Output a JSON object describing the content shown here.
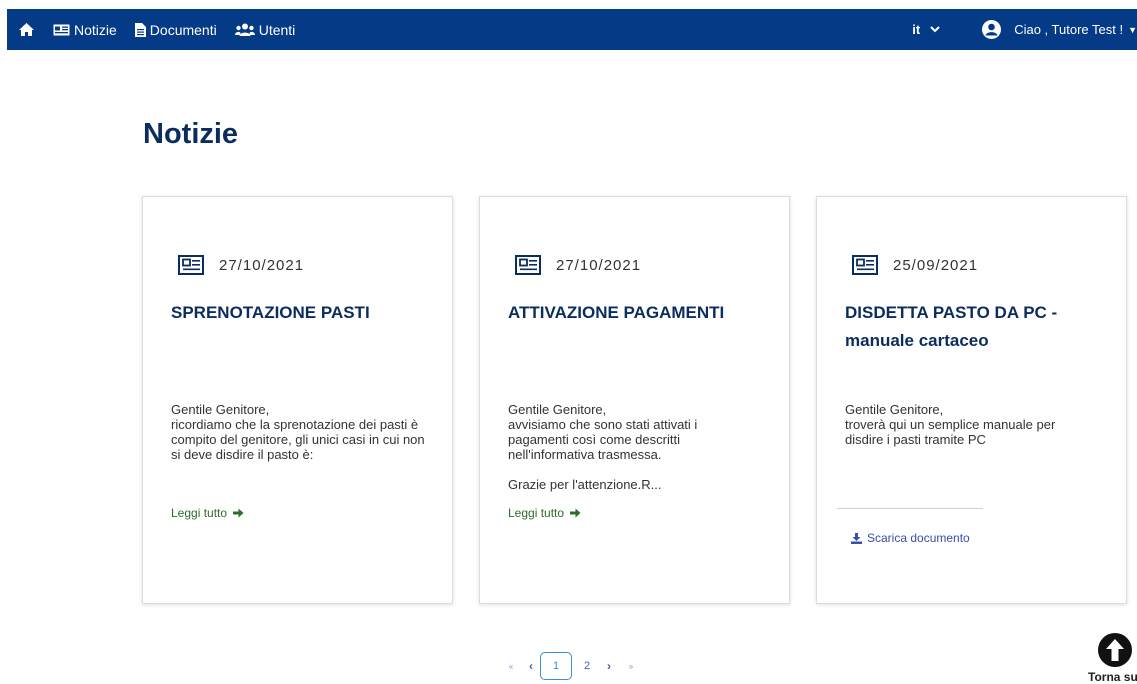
{
  "nav": {
    "home_icon": "home-icon",
    "items": [
      {
        "label": "Notizie",
        "icon": "newspaper-icon"
      },
      {
        "label": "Documenti",
        "icon": "document-icon"
      },
      {
        "label": "Utenti",
        "icon": "users-icon"
      }
    ],
    "language": "it",
    "greeting": "Ciao , Tutore Test !"
  },
  "page": {
    "title": "Notizie"
  },
  "cards": [
    {
      "date": "27/10/2021",
      "title": "SPRENOTAZIONE PASTI",
      "body": "Gentile Genitore,\nricordiamo che la sprenotazione dei pasti è\ncompito del genitore, gli unici casi in cui non\nsi deve disdire il pasto è:",
      "read_more": "Leggi tutto"
    },
    {
      "date": "27/10/2021",
      "title": "ATTIVAZIONE PAGAMENTI",
      "body": "Gentile Genitore,\navvisiamo che sono stati attivati i\npagamenti così come descritti\nnell'informativa trasmessa.",
      "extra": "Grazie per l'attenzione.R...",
      "read_more": "Leggi tutto"
    },
    {
      "date": "25/09/2021",
      "title": "DISDETTA PASTO DA PC -\nmanuale cartaceo",
      "body": "Gentile Genitore,\ntroverà qui un semplice manuale per\ndisdire i pasti tramite PC",
      "download": "Scarica documento"
    }
  ],
  "pagination": {
    "first": "«",
    "prev": "‹",
    "pages": [
      "1",
      "2"
    ],
    "current": "1",
    "next": "›",
    "last": "»"
  },
  "back_to_top": {
    "label": "Torna su"
  },
  "colors": {
    "navbar": "#043a86",
    "title": "#0b2d5e",
    "link_green": "#2c6e2c",
    "link_blue": "#3b4fa8"
  }
}
